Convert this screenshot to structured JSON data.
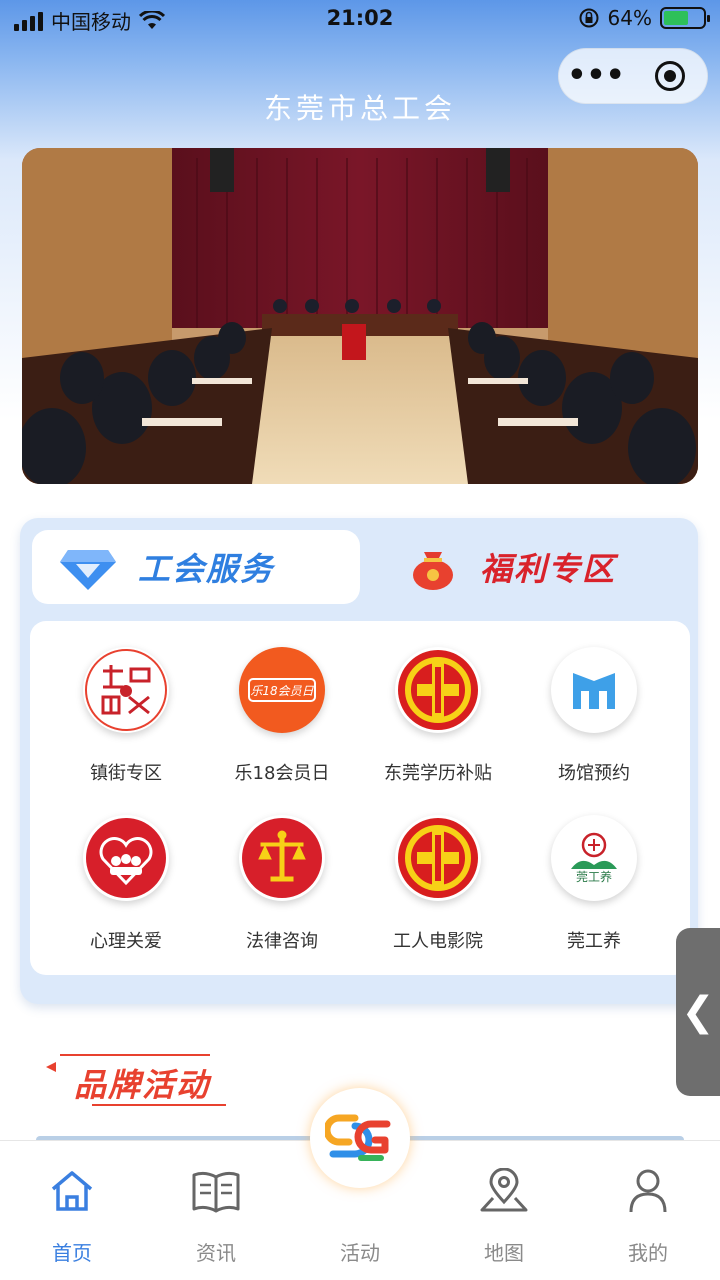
{
  "status_bar": {
    "carrier": "中国移动",
    "time": "21:02",
    "battery": "64%"
  },
  "header": {
    "title": "东莞市总工会"
  },
  "service_tabs": {
    "active": "工会服务",
    "inactive": "福利专区"
  },
  "grid": {
    "items": [
      {
        "label": "镇街专区",
        "icon": "town-district-icon"
      },
      {
        "label": "乐18会员日",
        "icon": "member-day-icon"
      },
      {
        "label": "东莞学历补贴",
        "icon": "union-emblem-icon"
      },
      {
        "label": "场馆预约",
        "icon": "venue-building-icon"
      },
      {
        "label": "心理关爱",
        "icon": "heart-care-icon"
      },
      {
        "label": "法律咨询",
        "icon": "scales-icon"
      },
      {
        "label": "工人电影院",
        "icon": "union-emblem-icon"
      },
      {
        "label": "莞工养",
        "icon": "guan-gong-yang-icon"
      }
    ],
    "member_day_badge": "乐18会员日",
    "guan_badge": "莞工养"
  },
  "brand_section": {
    "title": "品牌活动"
  },
  "tab_bar": {
    "items": [
      {
        "label": "首页",
        "icon": "home-icon",
        "active": true
      },
      {
        "label": "资讯",
        "icon": "book-icon",
        "active": false
      },
      {
        "label": "活动",
        "icon": "activity-logo-icon",
        "active": false
      },
      {
        "label": "地图",
        "icon": "map-pin-icon",
        "active": false
      },
      {
        "label": "我的",
        "icon": "user-icon",
        "active": false
      }
    ]
  },
  "side_handle": {
    "glyph": "❮"
  },
  "colors": {
    "accent_blue": "#3a7fe0",
    "accent_red": "#d9222b",
    "brand_orange": "#e8412f"
  }
}
